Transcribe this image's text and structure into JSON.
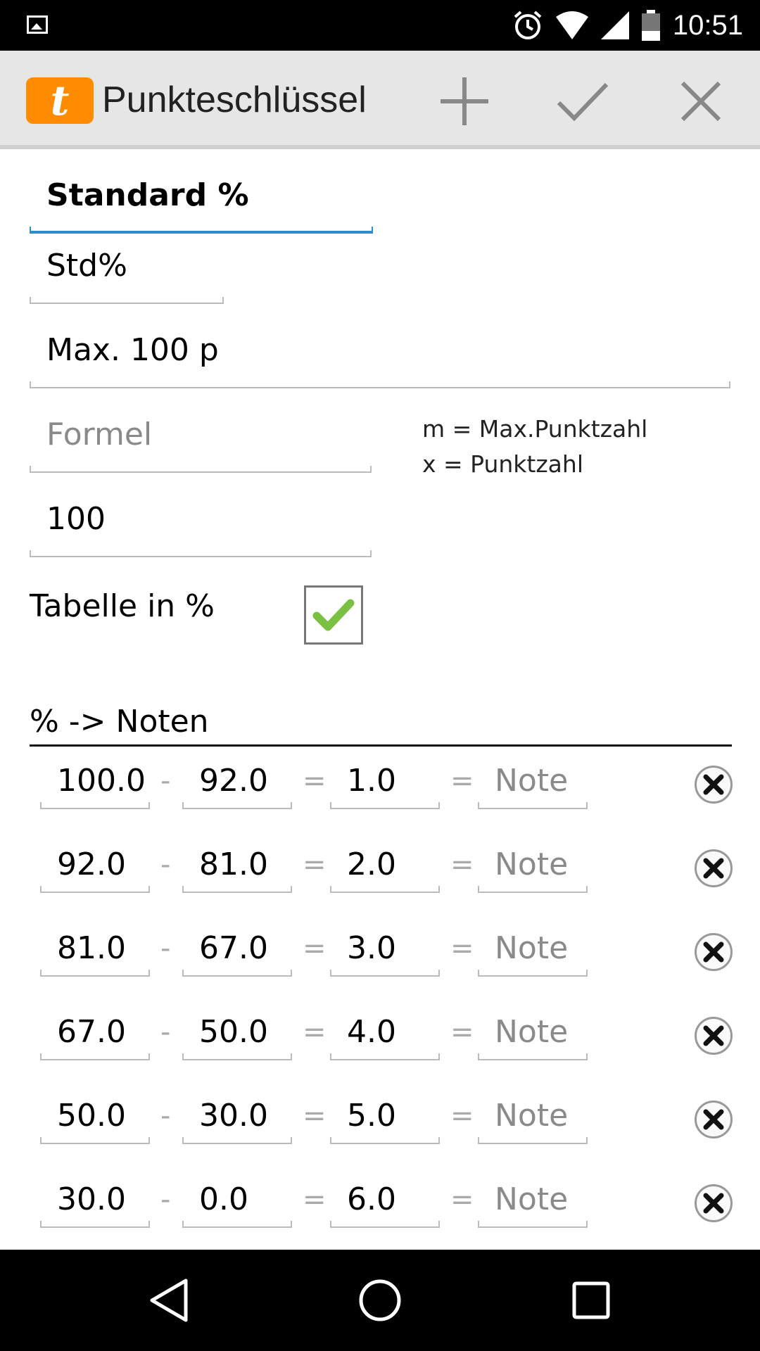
{
  "status_bar": {
    "time": "10:51",
    "icons": [
      "image-icon",
      "alarm-icon",
      "wifi-icon",
      "signal-icon",
      "battery-icon"
    ]
  },
  "action_bar": {
    "app_logo_letter": "t",
    "title": "Punkteschlüssel",
    "actions": [
      "add-icon",
      "confirm-icon",
      "close-icon"
    ]
  },
  "form": {
    "name": "Standard %",
    "short_name": "Std%",
    "description": "Max. 100 p",
    "formula_placeholder": "Formel",
    "formula_hint_1": "m = Max.Punktzahl",
    "formula_hint_2": "x = Punktzahl",
    "max_points": "100",
    "percent_table_label": "Tabelle in %",
    "percent_table_checked": true
  },
  "grades_section": {
    "title": "% -> Noten",
    "dash": "-",
    "equals": "=",
    "note_placeholder": "Note",
    "rows": [
      {
        "from": "100.0",
        "to": "92.0",
        "grade": "1.0"
      },
      {
        "from": "92.0",
        "to": "81.0",
        "grade": "2.0"
      },
      {
        "from": "81.0",
        "to": "67.0",
        "grade": "3.0"
      },
      {
        "from": "67.0",
        "to": "50.0",
        "grade": "4.0"
      },
      {
        "from": "50.0",
        "to": "30.0",
        "grade": "5.0"
      },
      {
        "from": "30.0",
        "to": "0.0",
        "grade": "6.0"
      }
    ]
  },
  "colors": {
    "accent": "#2a8fc9",
    "logo": "#ff8c00",
    "check": "#7ac143"
  }
}
